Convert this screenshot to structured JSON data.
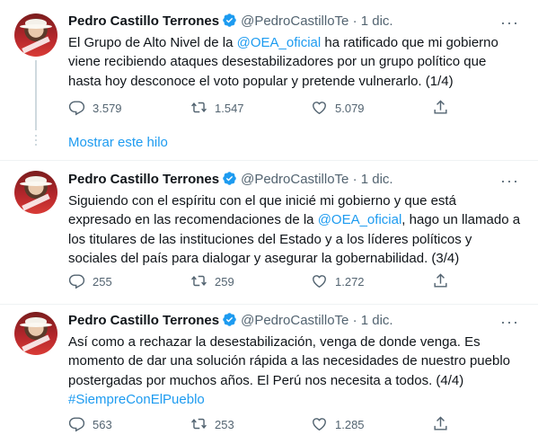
{
  "thread": {
    "show_thread_label": "Mostrar este hilo"
  },
  "tweets": [
    {
      "author_name": "Pedro Castillo Terrones",
      "handle": "@PedroCastilloTe",
      "separator": "·",
      "date": "1 dic.",
      "text_parts": [
        "El Grupo de Alto Nivel de la ",
        "@OEA_oficial",
        " ha ratificado que mi gobierno viene recibiendo ataques desestabilizadores por un grupo político que hasta hoy desconoce el voto popular y pretende vulnerarlo. (1/4)"
      ],
      "replies": "3.579",
      "retweets": "1.547",
      "likes": "5.079"
    },
    {
      "author_name": "Pedro Castillo Terrones",
      "handle": "@PedroCastilloTe",
      "separator": "·",
      "date": "1 dic.",
      "text_parts": [
        "Siguiendo con el espíritu con el que inicié mi gobierno y que está expresado en las recomendaciones de la ",
        "@OEA_oficial",
        ", hago un llamado a los titulares de las instituciones del Estado y a los líderes políticos y sociales del país para dialogar y asegurar la gobernabilidad. (3/4)"
      ],
      "replies": "255",
      "retweets": "259",
      "likes": "1.272"
    },
    {
      "author_name": "Pedro Castillo Terrones",
      "handle": "@PedroCastilloTe",
      "separator": "·",
      "date": "1 dic.",
      "text_parts": [
        "Así como a rechazar la desestabilización, venga de donde venga. Es momento de dar una solución rápida a las necesidades de nuestro pueblo postergadas por muchos años. El Perú nos necesita a todos. (4/4) ",
        "#SiempreConElPueblo",
        ""
      ],
      "replies": "563",
      "retweets": "253",
      "likes": "1.285"
    }
  ],
  "colors": {
    "link": "#1d9bf0",
    "secondary_text": "#536471",
    "primary_text": "#0f1419",
    "verified_badge": "#1d9bf0"
  },
  "icons": [
    "more-icon",
    "verified-badge-icon",
    "reply-icon",
    "retweet-icon",
    "like-icon",
    "share-icon"
  ]
}
